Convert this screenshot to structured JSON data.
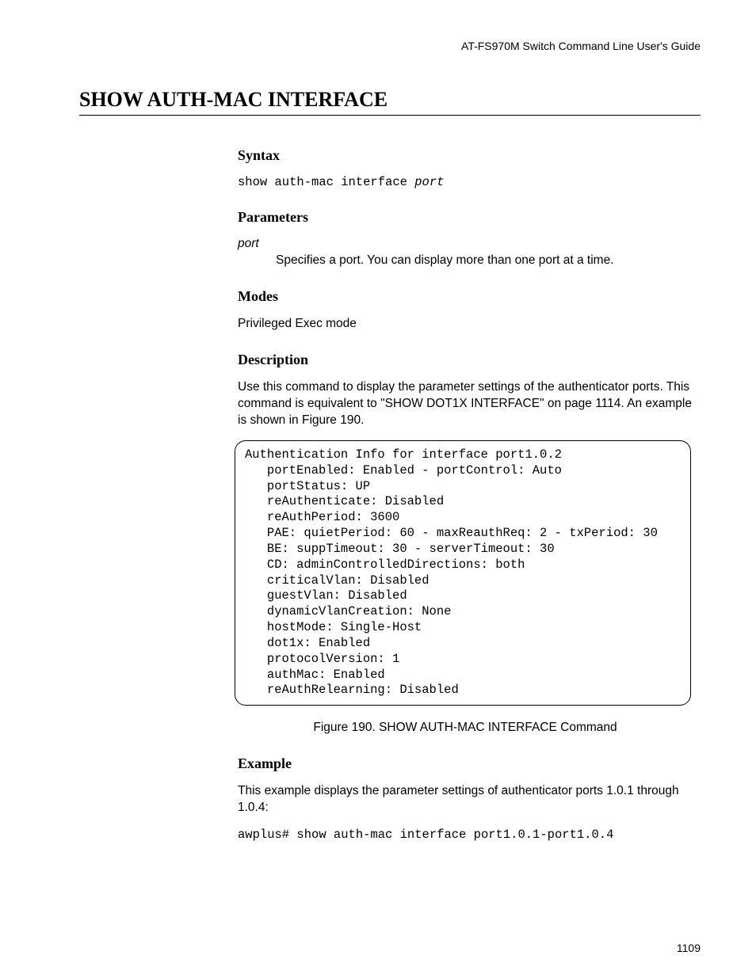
{
  "header": {
    "running": "AT-FS970M Switch Command Line User's Guide"
  },
  "title": "SHOW AUTH-MAC INTERFACE",
  "syntax": {
    "heading": "Syntax",
    "command": "show auth-mac interface ",
    "arg": "port"
  },
  "parameters": {
    "heading": "Parameters",
    "items": [
      {
        "name": "port",
        "desc": "Specifies a port. You can display more than one port at a time."
      }
    ]
  },
  "modes": {
    "heading": "Modes",
    "text": "Privileged Exec mode"
  },
  "description": {
    "heading": "Description",
    "text": "Use this command to display the parameter settings of the authenticator ports. This command is equivalent to \"SHOW DOT1X INTERFACE\" on page 1114. An example is shown in Figure 190."
  },
  "chart_data": {
    "type": "table",
    "title": "Authentication Info for interface port1.0.2",
    "settings": {
      "portEnabled": "Enabled",
      "portControl": "Auto",
      "portStatus": "UP",
      "reAuthenticate": "Disabled",
      "reAuthPeriod": 3600,
      "PAE": {
        "quietPeriod": 60,
        "maxReauthReq": 2,
        "txPeriod": 30
      },
      "BE": {
        "suppTimeout": 30,
        "serverTimeout": 30
      },
      "CD": {
        "adminControlledDirections": "both"
      },
      "criticalVlan": "Disabled",
      "guestVlan": "Disabled",
      "dynamicVlanCreation": "None",
      "hostMode": "Single-Host",
      "dot1x": "Enabled",
      "protocolVersion": 1,
      "authMac": "Enabled",
      "reAuthRelearning": "Disabled"
    },
    "raw_lines": [
      "Authentication Info for interface port1.0.2",
      "   portEnabled: Enabled - portControl: Auto",
      "   portStatus: UP",
      "   reAuthenticate: Disabled",
      "   reAuthPeriod: 3600",
      "   PAE: quietPeriod: 60 - maxReauthReq: 2 - txPeriod: 30",
      "   BE: suppTimeout: 30 - serverTimeout: 30",
      "   CD: adminControlledDirections: both",
      "   criticalVlan: Disabled",
      "   guestVlan: Disabled",
      "   dynamicVlanCreation: None",
      "   hostMode: Single-Host",
      "   dot1x: Enabled",
      "   protocolVersion: 1",
      "   authMac: Enabled",
      "   reAuthRelearning: Disabled"
    ]
  },
  "figure_caption": "Figure 190. SHOW AUTH-MAC INTERFACE Command",
  "example": {
    "heading": "Example",
    "intro": "This example displays the parameter settings of authenticator ports 1.0.1 through 1.0.4:",
    "command": "awplus# show auth-mac interface port1.0.1-port1.0.4"
  },
  "page_number": "1109"
}
